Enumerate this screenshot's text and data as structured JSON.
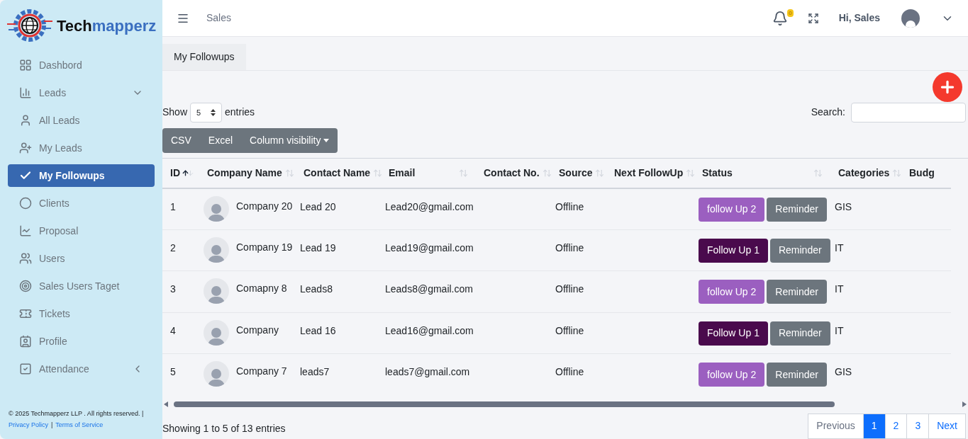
{
  "brand": {
    "name_part1": "Tech",
    "name_part2": "mapperz"
  },
  "sidebar": {
    "items": [
      {
        "label": "Dashbord",
        "kind": "link",
        "selected": false
      },
      {
        "label": "Leads",
        "kind": "group",
        "expanded": true,
        "selected": false
      },
      {
        "label": "All Leads",
        "kind": "link",
        "selected": false
      },
      {
        "label": "My Leads",
        "kind": "link",
        "selected": false
      },
      {
        "label": "My Followups",
        "kind": "link",
        "selected": true
      },
      {
        "label": "Clients",
        "kind": "link",
        "selected": false
      },
      {
        "label": "Proposal",
        "kind": "link",
        "selected": false
      },
      {
        "label": "Users",
        "kind": "link",
        "selected": false
      },
      {
        "label": "Sales Users Taget",
        "kind": "link",
        "selected": false
      },
      {
        "label": "Tickets",
        "kind": "link",
        "selected": false
      },
      {
        "label": "Profile",
        "kind": "link",
        "selected": false
      },
      {
        "label": "Attendance",
        "kind": "group",
        "expanded": false,
        "selected": false
      }
    ],
    "footer": {
      "copyright": "© 2025 Techmapperz LLP . All rights reserved. |",
      "links": [
        "Privacy Policy",
        "Terms of Service"
      ],
      "separator": "|"
    }
  },
  "header": {
    "breadcrumb": "Sales",
    "notifications": "0",
    "greeting": "Hi, Sales"
  },
  "tabs": [
    {
      "label": "My Followups",
      "selected": true
    }
  ],
  "table_controls": {
    "show_label": "Show",
    "page_size": "5",
    "entries_label": "entries",
    "search_label": "Search:",
    "export_buttons": [
      "CSV",
      "Excel",
      "Column visibility"
    ]
  },
  "table": {
    "columns": [
      {
        "label": "ID",
        "sorted": true
      },
      {
        "label": "Company Name",
        "sorted": false
      },
      {
        "label": "Contact Name",
        "sorted": false
      },
      {
        "label": "Email",
        "sorted": false
      },
      {
        "label": "Contact No.",
        "sorted": false
      },
      {
        "label": "Source",
        "sorted": false
      },
      {
        "label": "Next FollowUp",
        "sorted": false
      },
      {
        "label": "Status",
        "sorted": false
      },
      {
        "label": "Categories",
        "sorted": false
      },
      {
        "label": "Budg"
      }
    ],
    "rows": [
      {
        "id": "1",
        "company": "Company 20",
        "contact": "Lead 20",
        "email": "Lead20@gmail.com",
        "source": "Offline",
        "status": "follow Up 2",
        "color": "#9b5fc0",
        "reminder": "Reminder",
        "category": "GIS"
      },
      {
        "id": "2",
        "company": "Company 19",
        "contact": "Lead 19",
        "email": "Lead19@gmail.com",
        "source": "Offline",
        "status": "Follow Up 1",
        "color": "#4a0a4d",
        "reminder": "Reminder",
        "category": "IT"
      },
      {
        "id": "3",
        "company": "Comapny 8",
        "contact": "Leads8",
        "email": "Leads8@gmail.com",
        "source": "Offline",
        "status": "follow Up 2",
        "color": "#9b5fc0",
        "reminder": "Reminder",
        "category": "IT"
      },
      {
        "id": "4",
        "company": "Company",
        "contact": "Lead 16",
        "email": "Lead16@gmail.com",
        "source": "Offline",
        "status": "Follow Up 1",
        "color": "#4a0a4d",
        "reminder": "Reminder",
        "category": "IT"
      },
      {
        "id": "5",
        "company": "Company 7",
        "contact": "leads7",
        "email": "leads7@gmail.com",
        "source": "Offline",
        "status": "follow Up 2",
        "color": "#9b5fc0",
        "reminder": "Reminder",
        "category": "GIS"
      }
    ]
  },
  "footer": {
    "info": "Showing 1 to 5 of 13 entries",
    "pagination": [
      {
        "label": "Previous",
        "kind": "nav",
        "selected": false
      },
      {
        "label": "1",
        "kind": "page",
        "selected": true
      },
      {
        "label": "2",
        "kind": "page",
        "selected": false
      },
      {
        "label": "3",
        "kind": "page",
        "selected": false
      },
      {
        "label": "Next",
        "kind": "nav",
        "selected": false
      }
    ]
  }
}
